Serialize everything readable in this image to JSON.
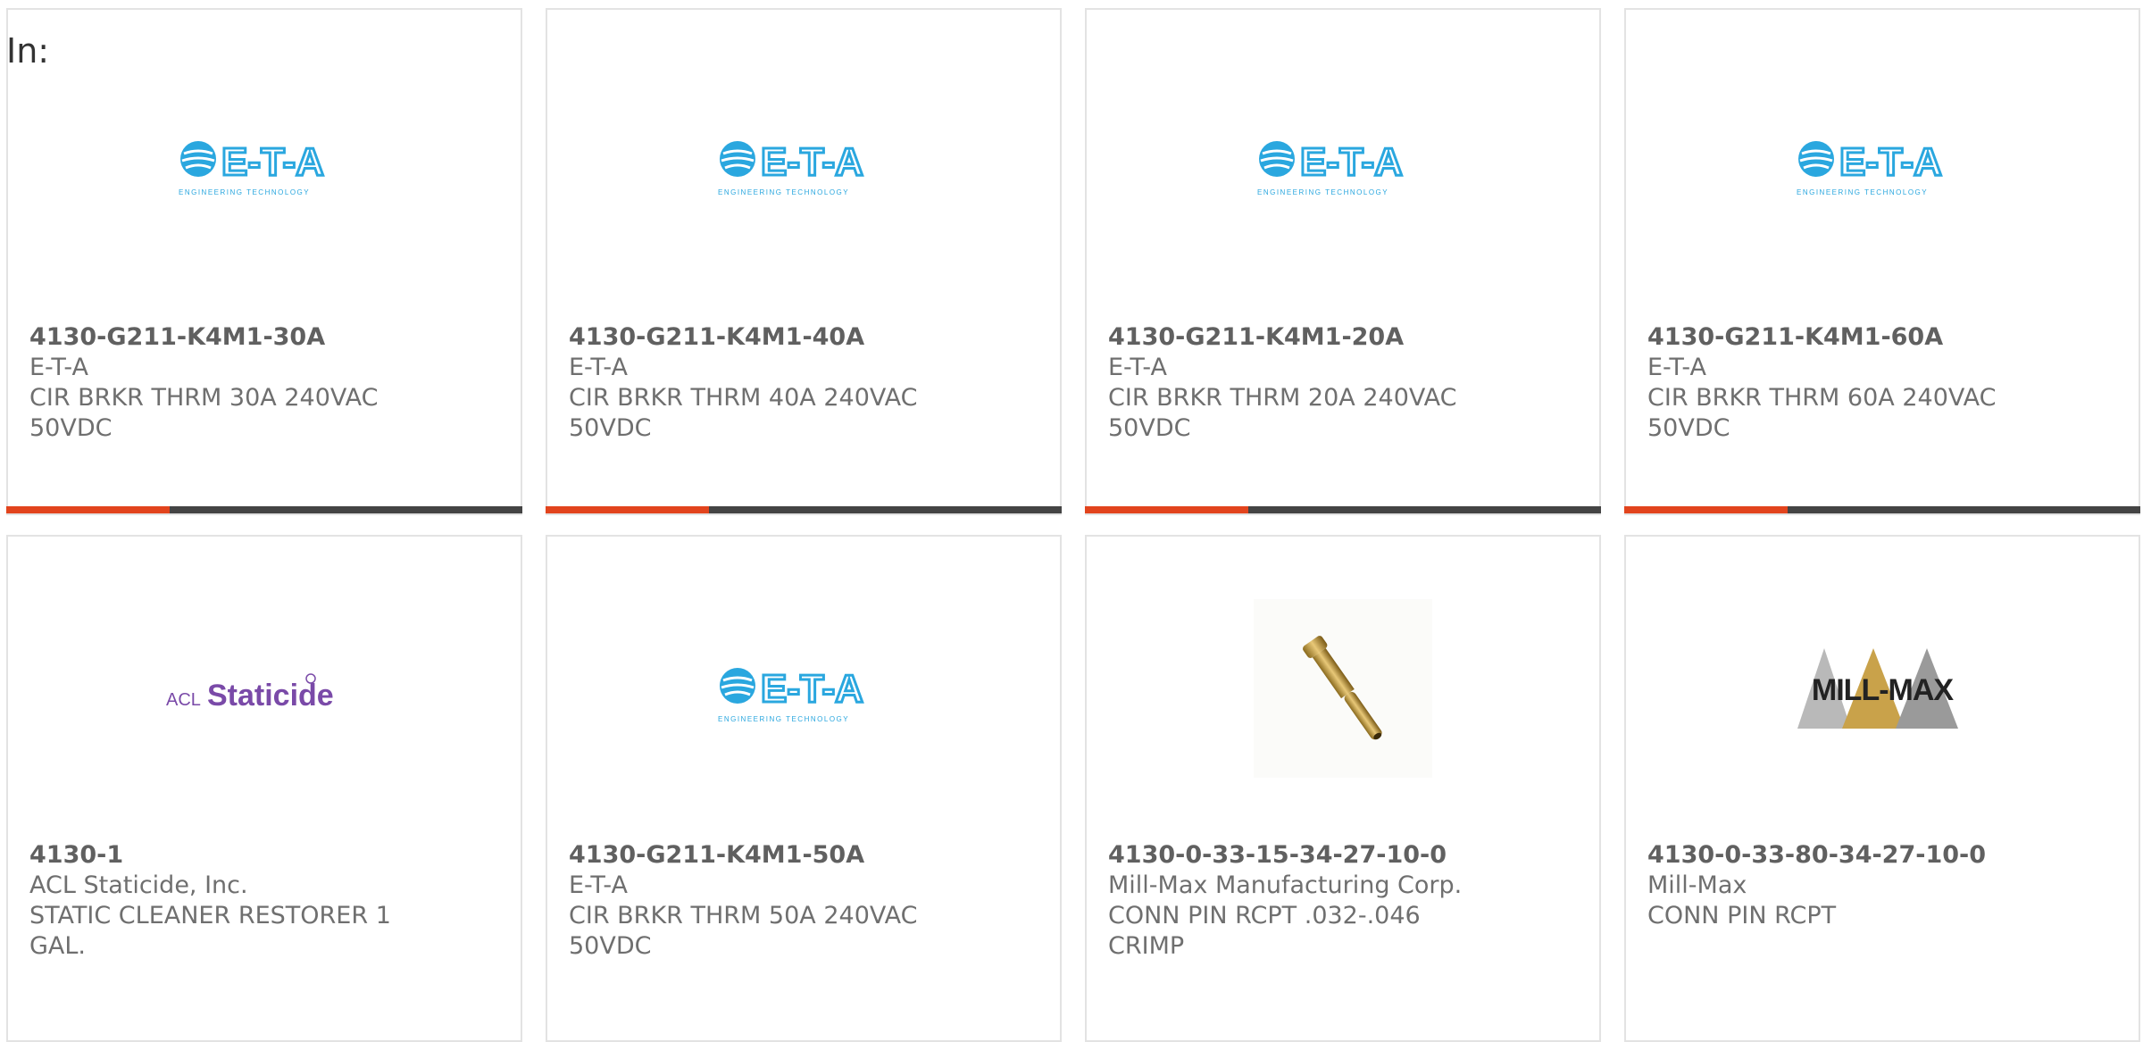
{
  "header": {
    "label": "In:"
  },
  "colors": {
    "accent": "#e2441d",
    "bar_dark": "#444444",
    "eta_blue": "#2aa7df",
    "staticide_purple": "#7a4aa8"
  },
  "products": [
    {
      "part_number": "4130-G211-K4M1-30A",
      "manufacturer": "E-T-A",
      "description": "CIR BRKR THRM 30A 240VAC 50VDC",
      "logo": "eta-logo",
      "logo_text": "E-T-A",
      "logo_sub": "ENGINEERING TECHNOLOGY"
    },
    {
      "part_number": "4130-G211-K4M1-40A",
      "manufacturer": "E-T-A",
      "description": "CIR BRKR THRM 40A 240VAC 50VDC",
      "logo": "eta-logo",
      "logo_text": "E-T-A",
      "logo_sub": "ENGINEERING TECHNOLOGY"
    },
    {
      "part_number": "4130-G211-K4M1-20A",
      "manufacturer": "E-T-A",
      "description": "CIR BRKR THRM 20A 240VAC 50VDC",
      "logo": "eta-logo",
      "logo_text": "E-T-A",
      "logo_sub": "ENGINEERING TECHNOLOGY"
    },
    {
      "part_number": "4130-G211-K4M1-60A",
      "manufacturer": "E-T-A",
      "description": "CIR BRKR THRM 60A 240VAC 50VDC",
      "logo": "eta-logo",
      "logo_text": "E-T-A",
      "logo_sub": "ENGINEERING TECHNOLOGY"
    },
    {
      "part_number": "4130-1",
      "manufacturer": "ACL Staticide, Inc.",
      "description": "STATIC CLEANER RESTORER 1 GAL.",
      "logo": "staticide-logo",
      "logo_text_small": "ACL",
      "logo_text": "Staticide"
    },
    {
      "part_number": "4130-G211-K4M1-50A",
      "manufacturer": "E-T-A",
      "description": "CIR BRKR THRM 50A 240VAC 50VDC",
      "logo": "eta-logo",
      "logo_text": "E-T-A",
      "logo_sub": "ENGINEERING TECHNOLOGY"
    },
    {
      "part_number": "4130-0-33-15-34-27-10-0",
      "manufacturer": "Mill-Max Manufacturing Corp.",
      "description": "CONN PIN RCPT .032-.046 CRIMP",
      "logo": "pin-photo"
    },
    {
      "part_number": "4130-0-33-80-34-27-10-0",
      "manufacturer": "Mill-Max",
      "description": "CONN PIN RCPT",
      "logo": "millmax-logo",
      "logo_text": "MILL-MAX"
    }
  ]
}
